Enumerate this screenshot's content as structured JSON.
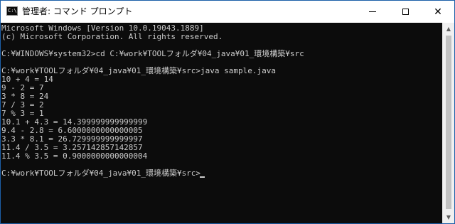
{
  "window": {
    "title": "管理者: コマンド プロンプト",
    "app_icon_label": "C:\\",
    "icons": {
      "app": "cmd-app-icon",
      "minimize": "minimize-icon",
      "maximize": "maximize-icon",
      "close": "close-icon",
      "scroll_up": "scroll-up-arrow-icon",
      "scroll_down": "scroll-down-arrow-icon"
    },
    "close_glyph": "✕",
    "scroll_up_glyph": "▲",
    "scroll_down_glyph": "▼"
  },
  "console": {
    "text_color": "#cccccc",
    "background": "#0c0c0c",
    "lines": [
      "Microsoft Windows [Version 10.0.19043.1889]",
      "(c) Microsoft Corporation. All rights reserved.",
      "",
      "C:¥WINDOWS¥system32>cd C:¥work¥TOOLフォルダ¥04_java¥01_環境構築¥src",
      "",
      "C:¥work¥TOOLフォルダ¥04_java¥01_環境構築¥src>java sample.java",
      "10 + 4 = 14",
      "9 - 2 = 7",
      "3 * 8 = 24",
      "7 / 3 = 2",
      "7 % 3 = 1",
      "10.1 + 4.3 = 14.399999999999999",
      "9.4 - 2.8 = 6.6000000000000005",
      "3.3 * 8.1 = 26.729999999999997",
      "11.4 / 3.5 = 3.257142857142857",
      "11.4 % 3.5 = 0.9000000000000004",
      "",
      "C:¥work¥TOOLフォルダ¥04_java¥01_環境構築¥src>"
    ]
  }
}
